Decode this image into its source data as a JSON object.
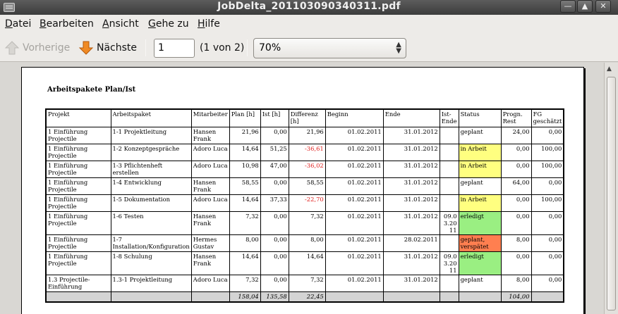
{
  "window": {
    "title": "JobDelta_201103090340311.pdf",
    "buttons": [
      "minimize-icon",
      "maximize-icon",
      "close-icon"
    ]
  },
  "menubar": {
    "items": [
      {
        "mn": "D",
        "rest": "atei"
      },
      {
        "mn": "B",
        "rest": "earbeiten"
      },
      {
        "mn": "A",
        "rest": "nsicht"
      },
      {
        "mn": "G",
        "rest": "ehe zu"
      },
      {
        "mn": "H",
        "rest": "ilfe"
      }
    ]
  },
  "toolbar": {
    "prev_label": "Vorherige",
    "next_label": "Nächste",
    "page_value": "1",
    "page_count": "(1 von 2)",
    "zoom_value": "70%"
  },
  "document": {
    "title": "Arbeitspakete Plan/Ist",
    "columns": [
      "Projekt",
      "Arbeitspaket",
      "Mitarbeiter",
      "Plan [h]",
      "Ist [h]",
      "Differenz [h]",
      "Beginn",
      "Ende",
      "Ist-Ende",
      "Status",
      "Progn. Rest",
      "FG geschätzt"
    ],
    "rows": [
      {
        "projekt": "1 Einführung Projectile",
        "paket": "1-1 Projektleitung",
        "mitarbeiter": "Hansen Frank",
        "plan": "21,96",
        "ist": "0,00",
        "diff": "21,96",
        "beginn": "01.02.2011",
        "ende": "31.01.2012",
        "istende": "",
        "status": "geplant",
        "rest": "24,00",
        "fg": "0,00"
      },
      {
        "projekt": "1 Einführung Projectile",
        "paket": "1-2 Konzeptgespräche",
        "mitarbeiter": "Adoro Luca",
        "plan": "14,64",
        "ist": "51,25",
        "diff": "-36,61",
        "beginn": "01.02.2011",
        "ende": "31.01.2012",
        "istende": "",
        "status": "in Arbeit",
        "rest": "0,00",
        "fg": "100,00"
      },
      {
        "projekt": "1 Einführung Projectile",
        "paket": "1-3 Pflichtenheft erstellen",
        "mitarbeiter": "Adoro Luca",
        "plan": "10,98",
        "ist": "47,00",
        "diff": "-36,02",
        "beginn": "01.02.2011",
        "ende": "31.01.2012",
        "istende": "",
        "status": "in Arbeit",
        "rest": "0,00",
        "fg": "100,00"
      },
      {
        "projekt": "1 Einführung Projectile",
        "paket": "1-4 Entwicklung",
        "mitarbeiter": "Hansen Frank",
        "plan": "58,55",
        "ist": "0,00",
        "diff": "58,55",
        "beginn": "01.02.2011",
        "ende": "31.01.2012",
        "istende": "",
        "status": "geplant",
        "rest": "64,00",
        "fg": "0,00"
      },
      {
        "projekt": "1 Einführung Projectile",
        "paket": "1-5 Dokumentation",
        "mitarbeiter": "Adoro Luca",
        "plan": "14,64",
        "ist": "37,33",
        "diff": "-22,70",
        "beginn": "01.02.2011",
        "ende": "31.01.2012",
        "istende": "",
        "status": "in Arbeit",
        "rest": "0,00",
        "fg": "100,00"
      },
      {
        "projekt": "1 Einführung Projectile",
        "paket": "1-6 Testen",
        "mitarbeiter": "Hansen Frank",
        "plan": "7,32",
        "ist": "0,00",
        "diff": "7,32",
        "beginn": "01.02.2011",
        "ende": "31.01.2012",
        "istende": "09.0 3.20 11",
        "status": "erledigt",
        "rest": "0,00",
        "fg": "0,00"
      },
      {
        "projekt": "1 Einführung Projectile",
        "paket": "1-7 Installation/Konfiguration",
        "mitarbeiter": "Hermes Gustav",
        "plan": "8,00",
        "ist": "0,00",
        "diff": "8,00",
        "beginn": "01.02.2011",
        "ende": "28.02.2011",
        "istende": "",
        "status": "geplant, verspätet",
        "rest": "8,00",
        "fg": "0,00"
      },
      {
        "projekt": "1 Einführung Projectile",
        "paket": "1-8 Schulung",
        "mitarbeiter": "Hansen Frank",
        "plan": "14,64",
        "ist": "0,00",
        "diff": "14,64",
        "beginn": "01.02.2011",
        "ende": "31.01.2012",
        "istende": "09.0 3.20 11",
        "status": "erledigt",
        "rest": "0,00",
        "fg": "0,00"
      },
      {
        "projekt": "1.3 Projectile-Einführung",
        "paket": "1.3-1 Projektleitung",
        "mitarbeiter": "Adoro Luca",
        "plan": "7,32",
        "ist": "0,00",
        "diff": "7,32",
        "beginn": "01.02.2011",
        "ende": "31.01.2012",
        "istende": "",
        "status": "geplant",
        "rest": "8,00",
        "fg": "0,00"
      }
    ],
    "totals": {
      "plan": "158,04",
      "ist": "135,58",
      "diff": "22,45",
      "rest": "104,00"
    },
    "status_colors": {
      "in Arbeit": "#ffff80",
      "erledigt": "#9aef82",
      "geplant, verspätet": "#ff7f50",
      "negative": "#e0201e"
    }
  }
}
